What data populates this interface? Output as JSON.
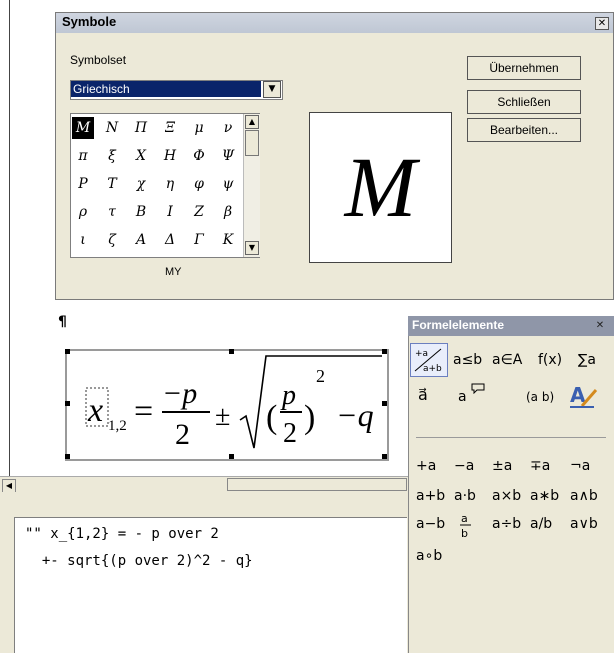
{
  "dialog": {
    "title": "Symbole",
    "symbolset_label": "Symbolset",
    "symbolset_value": "Griechisch",
    "symbols": [
      [
        "M",
        "N",
        "Π",
        "Ξ",
        "μ",
        "ν"
      ],
      [
        "π",
        "ξ",
        "X",
        "H",
        "Φ",
        "Ψ"
      ],
      [
        "P",
        "T",
        "χ",
        "η",
        "φ",
        "ψ"
      ],
      [
        "ρ",
        "τ",
        "B",
        "I",
        "Z",
        "β"
      ],
      [
        "ι",
        "ζ",
        "A",
        "Δ",
        "Γ",
        "K"
      ]
    ],
    "selected_symbol_name": "MY",
    "preview_glyph": "M",
    "buttons": {
      "apply": "Übernehmen",
      "close": "Schließen",
      "edit": "Bearbeiten..."
    }
  },
  "document": {
    "paragraph_mark": "¶",
    "formula": {
      "var": "x",
      "sub": "1,2",
      "minus_p": "−p",
      "den": "2",
      "pm": "±",
      "p": "p",
      "exp": "2",
      "q": "−q"
    }
  },
  "command": {
    "line1": "\"\" x_{1,2} = - p over 2",
    "line2": "  +- sqrt{(p over 2)^2 - q}"
  },
  "formula_elements": {
    "title": "Formelelemente",
    "categories": [
      "a≤b",
      "a∈A",
      "f(x)",
      "∑a",
      "a⃗",
      "a",
      "(a b)"
    ],
    "operators": [
      [
        "+a",
        "−a",
        "±a",
        "∓a",
        "¬a"
      ],
      [
        "a+b",
        "a·b",
        "a×b",
        "a∗b",
        "a∧b"
      ],
      [
        "a−b",
        "a÷b",
        "a/b",
        "a∨b"
      ],
      [
        "a∘b"
      ]
    ]
  },
  "colors": {
    "title_bar": "#c4cbd8",
    "select_highlight": "#0a246a",
    "panel": "#ece9d8"
  }
}
